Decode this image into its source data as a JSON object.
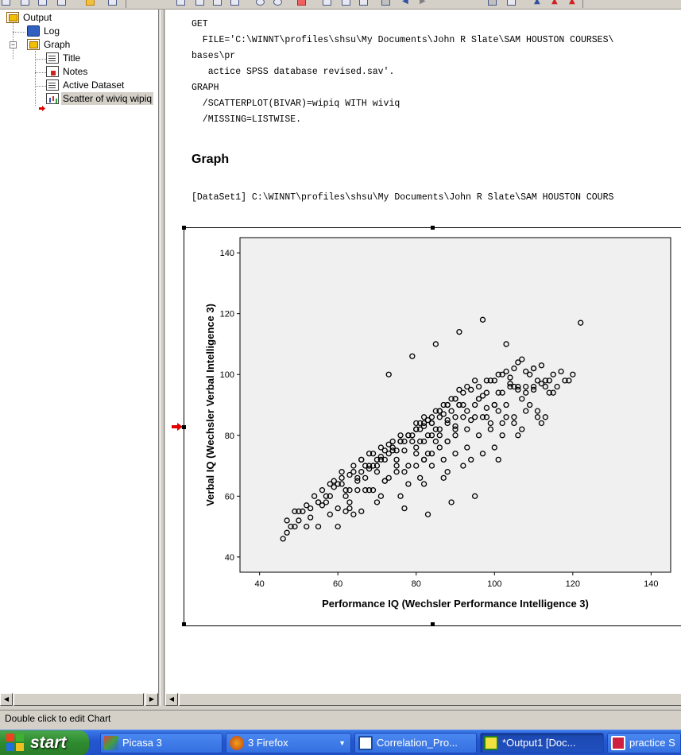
{
  "tree": {
    "items": [
      {
        "label": "Output",
        "icon": "output-book-icon"
      },
      {
        "label": "Log",
        "icon": "log-icon"
      },
      {
        "label": "Graph",
        "icon": "graph-book-icon"
      },
      {
        "label": "Title",
        "icon": "title-doc-icon"
      },
      {
        "label": "Notes",
        "icon": "notes-icon"
      },
      {
        "label": "Active Dataset",
        "icon": "dataset-doc-icon"
      },
      {
        "label": "Scatter of wiviq wipiq",
        "icon": "scatter-chart-icon"
      }
    ]
  },
  "syntax": {
    "lines": [
      "GET",
      "  FILE='C:\\WINNT\\profiles\\shsu\\My Documents\\John R Slate\\SAM HOUSTON COURSES\\",
      "bases\\pr",
      "   actice SPSS database revised.sav'.",
      "GRAPH",
      "  /SCATTERPLOT(BIVAR)=wipiq WITH wiviq",
      "  /MISSING=LISTWISE."
    ]
  },
  "output": {
    "heading": "Graph",
    "dataset_line": "[DataSet1] C:\\WINNT\\profiles\\shsu\\My Documents\\John R Slate\\SAM HOUSTON COURS"
  },
  "chart_data": {
    "type": "scatter",
    "title": "",
    "xlabel": "Performance IQ (Wechsler Performance Intelligence 3)",
    "ylabel": "Verbal IQ (Wechsler Verbal Intelligence 3)",
    "xlim": [
      35,
      145
    ],
    "ylim": [
      35,
      145
    ],
    "xticks": [
      40,
      60,
      80,
      100,
      120,
      140
    ],
    "yticks": [
      40,
      60,
      80,
      100,
      120,
      140
    ],
    "plot_bg": "#f0f0f0",
    "marker": "open-circle",
    "x": [
      46,
      47,
      48,
      49,
      50,
      51,
      52,
      53,
      54,
      55,
      56,
      57,
      58,
      59,
      60,
      61,
      62,
      63,
      64,
      65,
      66,
      67,
      68,
      69,
      70,
      71,
      72,
      73,
      74,
      75,
      76,
      77,
      78,
      79,
      80,
      81,
      82,
      83,
      84,
      85,
      86,
      87,
      88,
      89,
      90,
      91,
      92,
      93,
      94,
      95,
      96,
      97,
      98,
      99,
      100,
      101,
      102,
      103,
      104,
      105,
      106,
      107,
      108,
      109,
      110,
      111,
      112,
      113,
      114,
      115,
      116,
      117,
      118,
      119,
      120,
      122,
      47,
      49,
      52,
      55,
      58,
      61,
      63,
      65,
      67,
      69,
      71,
      73,
      75,
      77,
      79,
      81,
      83,
      85,
      87,
      89,
      91,
      93,
      95,
      97,
      99,
      101,
      103,
      105,
      107,
      109,
      111,
      113,
      115,
      50,
      53,
      56,
      59,
      62,
      64,
      66,
      68,
      70,
      72,
      74,
      76,
      78,
      80,
      82,
      84,
      86,
      88,
      90,
      92,
      94,
      96,
      98,
      100,
      102,
      104,
      106,
      108,
      110,
      112,
      114,
      60,
      63,
      66,
      69,
      72,
      75,
      78,
      81,
      84,
      87,
      90,
      93,
      96,
      99,
      102,
      105,
      108,
      111,
      57,
      62,
      67,
      72,
      77,
      82,
      87,
      92,
      97,
      102,
      107,
      64,
      70,
      76,
      82,
      88,
      94,
      100,
      106,
      112,
      73,
      79,
      85,
      91,
      97,
      103,
      68,
      74,
      80,
      86,
      92,
      98,
      104,
      110,
      61,
      66,
      71,
      76,
      81,
      86,
      91,
      96,
      101,
      106,
      55,
      60,
      65,
      70,
      75,
      80,
      85,
      90,
      95,
      100,
      105,
      110,
      58,
      63,
      68,
      73,
      78,
      83,
      88,
      93,
      98,
      103,
      108,
      113,
      71,
      77,
      83,
      89,
      95,
      101,
      80,
      82,
      84,
      86,
      88,
      90,
      80,
      82,
      84,
      86,
      88,
      90,
      80,
      82,
      84,
      86,
      88,
      90
    ],
    "y": [
      46,
      48,
      50,
      50,
      52,
      55,
      50,
      56,
      60,
      58,
      57,
      60,
      64,
      63,
      64,
      66,
      62,
      67,
      70,
      65,
      68,
      70,
      69,
      74,
      70,
      73,
      72,
      77,
      75,
      72,
      78,
      75,
      80,
      78,
      82,
      78,
      83,
      80,
      84,
      82,
      80,
      87,
      85,
      88,
      83,
      90,
      86,
      88,
      85,
      90,
      92,
      86,
      89,
      84,
      90,
      88,
      94,
      86,
      96,
      84,
      95,
      92,
      96,
      90,
      95,
      88,
      97,
      86,
      94,
      100,
      96,
      101,
      98,
      98,
      100,
      117,
      52,
      55,
      57,
      58,
      60,
      64,
      62,
      66,
      66,
      70,
      72,
      74,
      75,
      78,
      80,
      82,
      85,
      88,
      90,
      92,
      95,
      96,
      98,
      93,
      98,
      100,
      101,
      102,
      105,
      100,
      98,
      96,
      94,
      55,
      53,
      62,
      65,
      60,
      68,
      72,
      70,
      72,
      75,
      76,
      78,
      80,
      84,
      86,
      84,
      88,
      90,
      92,
      94,
      95,
      96,
      98,
      98,
      100,
      99,
      104,
      101,
      102,
      103,
      98,
      50,
      56,
      55,
      62,
      65,
      68,
      64,
      66,
      70,
      72,
      74,
      76,
      80,
      82,
      84,
      86,
      88,
      86,
      58,
      55,
      62,
      65,
      68,
      72,
      66,
      70,
      74,
      80,
      82,
      54,
      58,
      60,
      64,
      68,
      72,
      76,
      80,
      84,
      100,
      106,
      110,
      114,
      118,
      110,
      74,
      78,
      82,
      86,
      90,
      94,
      97,
      96,
      68,
      72,
      76,
      80,
      84,
      88,
      90,
      92,
      94,
      96,
      50,
      56,
      62,
      68,
      70,
      74,
      78,
      82,
      86,
      90,
      96,
      102,
      54,
      58,
      62,
      66,
      70,
      74,
      78,
      82,
      86,
      90,
      94,
      98,
      60,
      56,
      54,
      58,
      60,
      72,
      82,
      84,
      86,
      88,
      90,
      92,
      76,
      78,
      80,
      82,
      84,
      86,
      70,
      72,
      74,
      76,
      78,
      80
    ]
  },
  "status": {
    "text": "Double click to edit Chart"
  },
  "taskbar": {
    "start_label": "start",
    "tasks": [
      {
        "label": "Picasa 3",
        "icon": "picasa-icon"
      },
      {
        "label": "3 Firefox",
        "icon": "firefox-icon"
      },
      {
        "label": "Correlation_Pro...",
        "icon": "word-icon"
      },
      {
        "label": "*Output1 [Doc...",
        "icon": "spss-output-icon"
      },
      {
        "label": "practice S",
        "icon": "spss-data-icon"
      }
    ]
  }
}
